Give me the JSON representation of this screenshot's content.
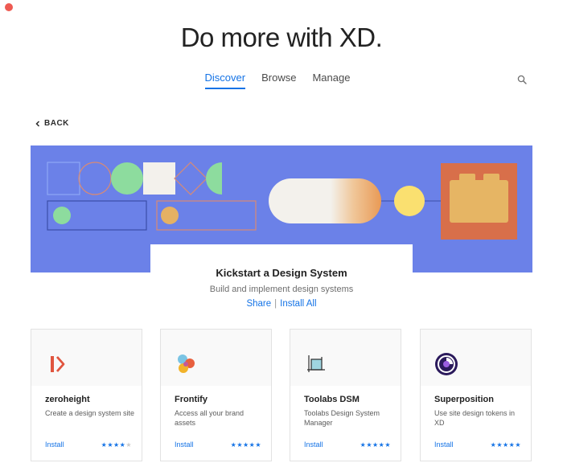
{
  "window": {
    "close_color": "#ee5a52"
  },
  "header": {
    "title": "Do more with XD."
  },
  "tabs": [
    {
      "label": "Discover",
      "active": true
    },
    {
      "label": "Browse",
      "active": false
    },
    {
      "label": "Manage",
      "active": false
    }
  ],
  "back_label": "BACK",
  "hero": {
    "title": "Kickstart a Design System",
    "subtitle": "Build and implement design systems",
    "share_label": "Share",
    "separator": "|",
    "install_all_label": "Install All",
    "background_color": "#6b81e8"
  },
  "accent_color": "#1473e6",
  "plugins": [
    {
      "name": "zeroheight",
      "description": "Create a design system site",
      "install_label": "Install",
      "rating": 4,
      "max_rating": 5,
      "icon": "zeroheight-logo-icon"
    },
    {
      "name": "Frontify",
      "description": "Access all your brand assets",
      "install_label": "Install",
      "rating": 5,
      "max_rating": 5,
      "icon": "frontify-logo-icon"
    },
    {
      "name": "Toolabs DSM",
      "description": "Toolabs Design System Manager",
      "install_label": "Install",
      "rating": 5,
      "max_rating": 5,
      "icon": "toolabs-logo-icon"
    },
    {
      "name": "Superposition",
      "description": "Use site design tokens in XD",
      "install_label": "Install",
      "rating": 5,
      "max_rating": 5,
      "icon": "superposition-logo-icon"
    }
  ]
}
